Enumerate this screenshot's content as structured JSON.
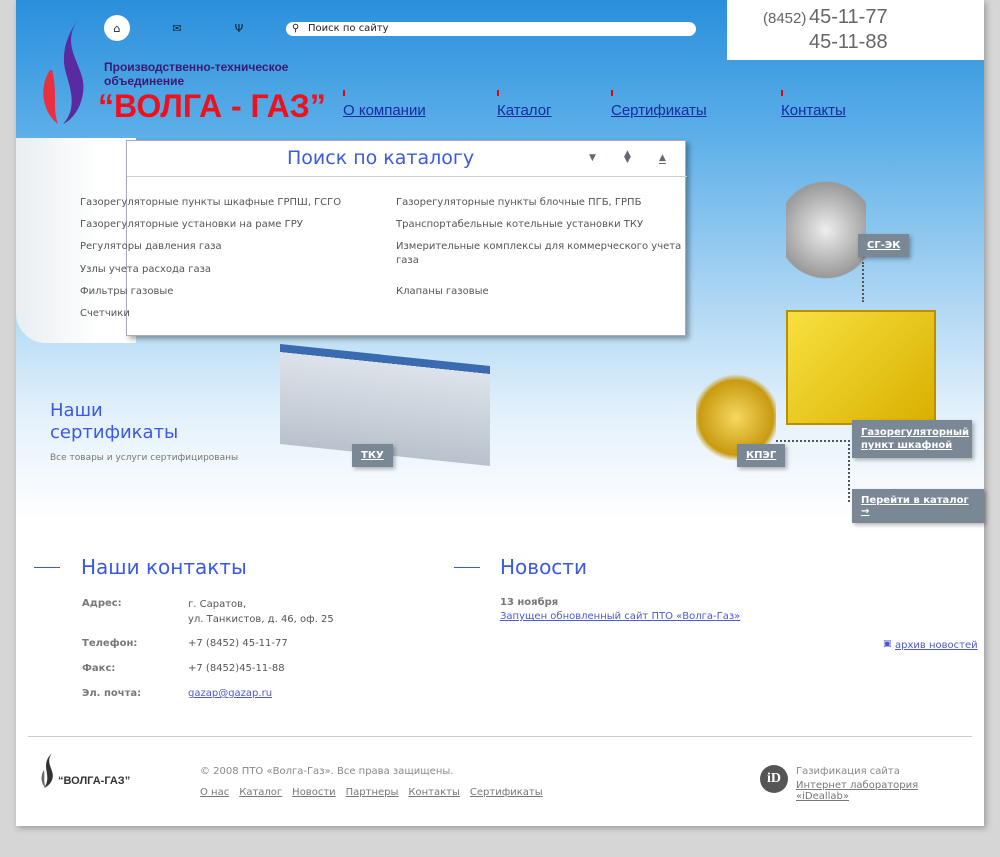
{
  "header": {
    "search_placeholder": "Поиск по сайту",
    "company_line1": "Производственно-техническое",
    "company_line2": "объединение",
    "brand": "“ВОЛГА - ГАЗ”",
    "phone_code": "(8452)",
    "phone1": "45-11-77",
    "phone2": "45-11-88",
    "icons": [
      "home-icon",
      "mail-icon",
      "sitemap-icon",
      "search-icon"
    ]
  },
  "nav": [
    "О компании",
    "Каталог",
    "Сертификаты",
    "Контакты"
  ],
  "catalog": {
    "title": "Поиск по каталогу",
    "left": [
      "Газорегуляторные пункты шкафные ГРПШ, ГСГО",
      "Газорегуляторные установки на раме ГРУ",
      "Регуляторы давления газа",
      "Узлы учета расхода газа",
      "Фильтры газовые",
      "Счетчики"
    ],
    "right": [
      "Газорегуляторные пункты блочные ПГБ, ГРПБ",
      "Транспортабельные котельные установки ТКУ",
      "Измерительные комплексы для коммерческого учета газа",
      "Клапаны газовые"
    ]
  },
  "certs": {
    "title_line1": "Наши",
    "title_line2": "сертификаты",
    "subtitle": "Все товары и услуги сертифицированы"
  },
  "products": {
    "sgek": "СГ-ЭК",
    "tku": "ТКУ",
    "kpeg": "КПЭГ",
    "grpsh": "Газорегуляторный пункт шкафной",
    "goto": "Перейти в каталог →"
  },
  "contacts": {
    "title": "Наши контакты",
    "address_label": "Адрес:",
    "address1": "г. Саратов,",
    "address2": "ул. Танкистов, д. 46, оф. 25",
    "phone_label": "Телефон:",
    "phone": "+7 (8452) 45-11-77",
    "fax_label": "Факс:",
    "fax": "+7 (8452)45-11-88",
    "email_label": "Эл. почта:",
    "email": "gazap@gazap.ru"
  },
  "news": {
    "title": "Новости",
    "date": "13 ноября",
    "item": "Запущен обновленный сайт ПТО «Волга-Газ»",
    "archive": "архив новостей"
  },
  "footer": {
    "logo_text": "“ВОЛГА-ГАЗ”",
    "copyright": "© 2008 ПТО «Волга-Газ». Все права защищены.",
    "links": [
      "О нас",
      "Каталог",
      "Новости",
      "Партнеры",
      "Контакты",
      "Сертификаты"
    ],
    "dev_line1": "Газификация сайта",
    "dev_line2": "Интернет лаборатория «iDeallab»"
  }
}
